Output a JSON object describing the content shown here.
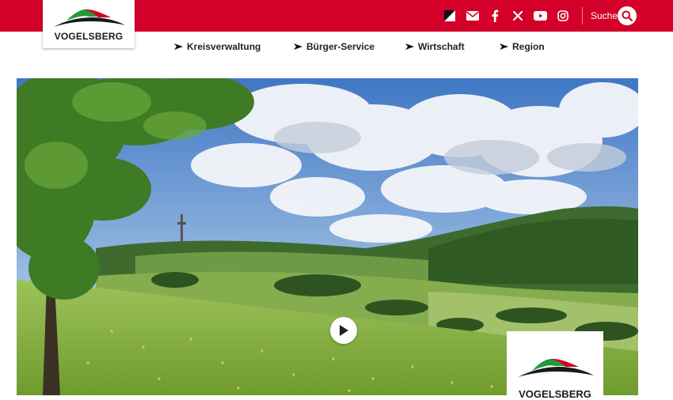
{
  "header": {
    "logo_text": "VOGELSBERG",
    "brand_color": "#d3002a",
    "search_label": "Suche",
    "social_icons": [
      "contrast-icon",
      "mail-icon",
      "facebook-icon",
      "x-icon",
      "youtube-icon",
      "instagram-icon"
    ]
  },
  "nav": {
    "items": [
      {
        "label": "Kreisverwaltung"
      },
      {
        "label": "Bürger-Service"
      },
      {
        "label": "Wirtschaft"
      },
      {
        "label": "Region"
      }
    ]
  },
  "hero": {
    "image": "landscape-photo",
    "play_icon": "play-icon",
    "badge_logo_text": "VOGELSBERG"
  }
}
